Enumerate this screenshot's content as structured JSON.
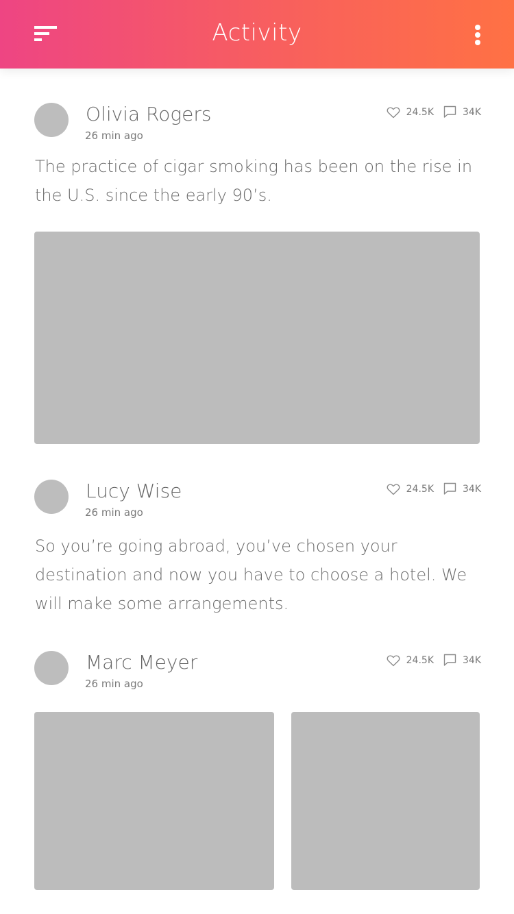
{
  "header": {
    "title": "Activity",
    "menu_icon": "menu-icon",
    "more_icon": "more-vertical-icon",
    "gradient_start": "#ee4583",
    "gradient_end": "#ff7144"
  },
  "posts": [
    {
      "author": "Olivia Rogers",
      "time": "26 min ago",
      "likes": "24.5K",
      "comments": "34K",
      "text": "The practice of cigar smoking has been on the rise in the U.S. since the early 90’s.",
      "images": 1
    },
    {
      "author": "Lucy Wise",
      "time": "26 min ago",
      "likes": "24.5K",
      "comments": "34K",
      "text": "So you’re going abroad, you’ve chosen your destination and now you have to choose a hotel. We will make some arrangements.",
      "images": 0
    },
    {
      "author": "Marc Meyer",
      "time": "26 min ago",
      "likes": "24.5K",
      "comments": "34K",
      "text": "",
      "images": 2
    }
  ]
}
